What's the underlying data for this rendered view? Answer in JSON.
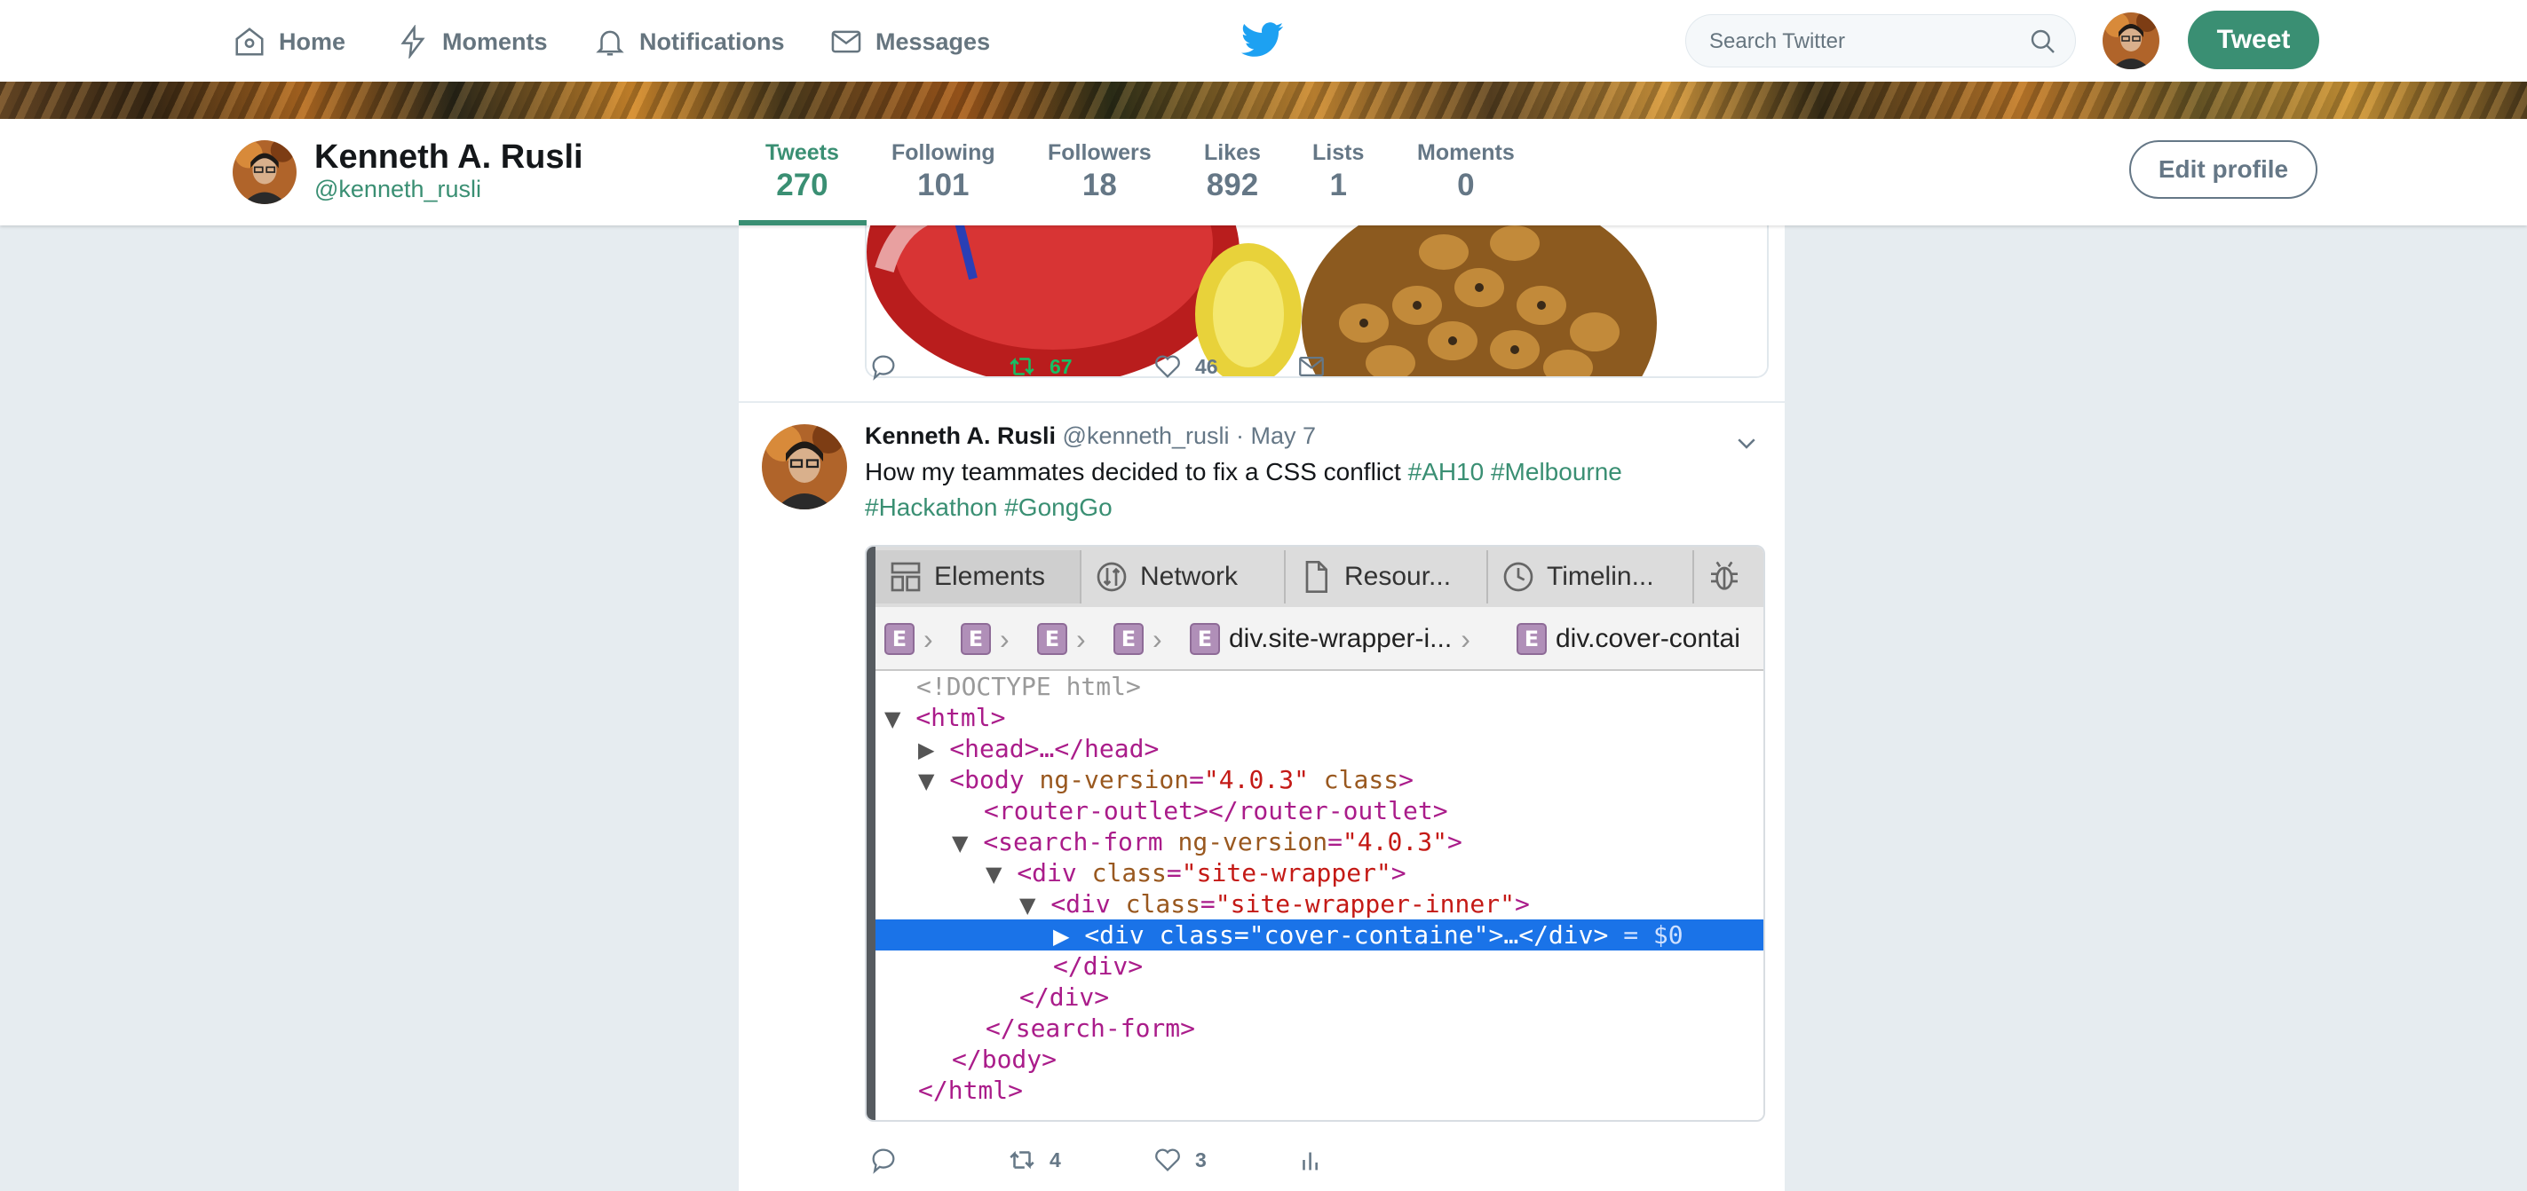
{
  "topnav": {
    "home": "Home",
    "moments": "Moments",
    "notifications": "Notifications",
    "messages": "Messages",
    "search_placeholder": "Search Twitter",
    "tweet_button": "Tweet"
  },
  "profile": {
    "name": "Kenneth A. Rusli",
    "handle": "@kenneth_rusli",
    "edit_button": "Edit profile",
    "stats": [
      {
        "label": "Tweets",
        "value": "270"
      },
      {
        "label": "Following",
        "value": "101"
      },
      {
        "label": "Followers",
        "value": "18"
      },
      {
        "label": "Likes",
        "value": "892"
      },
      {
        "label": "Lists",
        "value": "1"
      },
      {
        "label": "Moments",
        "value": "0"
      }
    ]
  },
  "prev_tweet": {
    "retweets": "67",
    "likes": "46"
  },
  "tweet": {
    "name": "Kenneth A. Rusli",
    "handle": "@kenneth_rusli",
    "separator": " · ",
    "date": "May 7",
    "text": "How my teammates decided to fix a CSS conflict",
    "hashtags": [
      "#AH10",
      "#Melbourne",
      "#Hackathon",
      "#GongGo"
    ],
    "retweets": "4",
    "likes": "3"
  },
  "devtools": {
    "tabs": [
      "Elements",
      "Network",
      "Resour...",
      "Timelin..."
    ],
    "badge": "E",
    "crumbs": [
      "div.site-wrapper-i...",
      "div.cover-contai"
    ],
    "code": {
      "doctype": "<!DOCTYPE html>",
      "html_open": "<html>",
      "head": "<head>…</head>",
      "body_tag": "<body",
      "body_attr": " ng-version",
      "body_eq": "=",
      "body_val": "\"4.0.3\"",
      "body_attr2": " class",
      "body_close": ">",
      "router": "<router-outlet></router-outlet>",
      "search_tag": "<search-form",
      "search_attr": " ng-version",
      "search_eq": "=",
      "search_val": "\"4.0.3\"",
      "search_close": ">",
      "div_tag": "<div",
      "div_attr": " class",
      "div_eq": "=",
      "div1_val": "\"site-wrapper\"",
      "div2_val": "\"site-wrapper-inner\"",
      "div3_val": "\"cover-containe\"",
      "tag_close": ">",
      "div3_rest": ">…</div>",
      "dollar": " = $0",
      "div_end": "</div>",
      "search_end": "</search-form>",
      "body_end": "</body>",
      "html_end": "</html>"
    }
  },
  "colors": {
    "accent": "#3a8f73",
    "twitter_blue": "#1da1f2",
    "retweet_green": "#17bf63",
    "devtools_highlight": "#1a73e8"
  }
}
